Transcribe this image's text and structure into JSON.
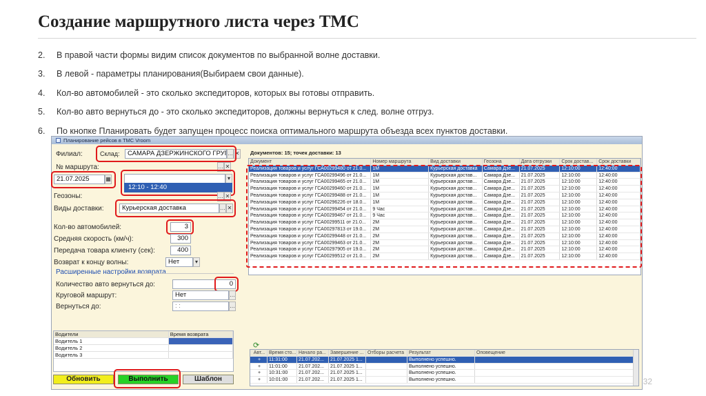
{
  "slide": {
    "title": "Создание маршрутного листа через ТМС",
    "points": [
      {
        "num": "2.",
        "text": "В правой части формы видим список  документов по выбранной волне доставки."
      },
      {
        "num": "3.",
        "text": "В левой - параметры планирования(Выбираем свои данные)."
      },
      {
        "num": "4.",
        "text": "Кол-во автомобилей - это сколько экспедиторов, которых вы готовы отправить."
      },
      {
        "num": "5.",
        "text": "Кол-во авто вернуться до - это сколько экспедиторов, должны вернуться к след. волне отгруз."
      },
      {
        "num": "6.",
        "text": "По кнопке Планировать будет запущен процесс поиска оптимального маршрута объезда всех пунктов доставки."
      }
    ],
    "page_number": "32"
  },
  "window": {
    "title": "Планирование рейсов в ТМС Vroom",
    "form": {
      "branch_label": "Филиал:",
      "warehouse_label": "Склад:",
      "warehouse_value": "САМАРА ДЗЕРЖИНСКОГО ГРУППА",
      "route_label": "№ маршрута:",
      "date_value": "21.07.2025",
      "wave_value": "",
      "wave_option": "12:10 - 12:40",
      "geozones_label": "Геозоны:",
      "delivery_types_label": "Виды доставки:",
      "delivery_types_value": "Курьерская доставка",
      "cars_label": "Кол-во автомобилей:",
      "cars_value": "3",
      "speed_label": "Средняя скорость (км/ч):",
      "speed_value": "300",
      "handover_label": "Передача товара клиенту (сек):",
      "handover_value": "400",
      "return_label": "Возврат к концу волны:",
      "return_value": "Нет",
      "advanced_title": "Расширенные настройки возврата",
      "return_cars_label": "Количество авто вернуться до:",
      "return_cars_value": "0",
      "circular_label": "Круговой маршрут:",
      "circular_value": "Нет",
      "return_until_label": "Вернуться до:",
      "return_until_value": ": :"
    },
    "drivers": {
      "headers": [
        "Водители",
        "Время возврата"
      ],
      "rows": [
        "Водитель 1",
        "Водитель 2",
        "Водитель 3"
      ]
    },
    "buttons": {
      "refresh": "Обновить",
      "run": "Выполнить",
      "template": "Шаблон"
    },
    "documents": {
      "caption": "Документов: 15; точек доставки: 13",
      "headers": [
        "Документ",
        "Номер маршрута",
        "Вид доставки",
        "Геозона",
        "Дата отгрузки",
        "Срок достав...",
        "Срок доставки"
      ],
      "rows": [
        [
          "Реализация товаров и услуг ГСА00299480 от 21.0...",
          "1М",
          "Курьерская доставка",
          "Самара Дзе...",
          "21.07.2025",
          "12:10:00",
          "12:40:00"
        ],
        [
          "Реализация товаров и услуг ГСА00299496 от 21.0...",
          "1М",
          "Курьерская достав...",
          "Самара Дзе...",
          "21.07.2025",
          "12:10:00",
          "12:40:00"
        ],
        [
          "Реализация товаров и услуг ГСА00299465 от 21.0...",
          "1М",
          "Курьерская достав...",
          "Самара Дзе...",
          "21.07.2025",
          "12:10:00",
          "12:40:00"
        ],
        [
          "Реализация товаров и услуг ГСА00299460 от 21.0...",
          "1М",
          "Курьерская достав...",
          "Самара Дзе...",
          "21.07.2025",
          "12:10:00",
          "12:40:00"
        ],
        [
          "Реализация товаров и услуг ГСА00299488 от 21.0...",
          "1М",
          "Курьерская достав...",
          "Самара Дзе...",
          "21.07.2025",
          "12:10:00",
          "12:40:00"
        ],
        [
          "Реализация товаров и услуг ГСА00296226 от 18.0...",
          "1М",
          "Курьерская достав...",
          "Самара Дзе...",
          "21.07.2025",
          "12:10:00",
          "12:40:00"
        ],
        [
          "Реализация товаров и услуг ГСА00299454 от 21.0...",
          "9 Час",
          "Курьерская достав...",
          "Самара Дзе...",
          "21.07.2025",
          "12:10:00",
          "12:40:00"
        ],
        [
          "Реализация товаров и услуг ГСА00299467 от 21.0...",
          "9 Час",
          "Курьерская достав...",
          "Самара Дзе...",
          "21.07.2025",
          "12:10:00",
          "12:40:00"
        ],
        [
          "Реализация товаров и услуг ГСА00299511 от 21.0...",
          "2М",
          "Курьерская достав...",
          "Самара Дзе...",
          "21.07.2025",
          "12:10:00",
          "12:40:00"
        ],
        [
          "Реализация товаров и услуг ГСА00297813 от 19.0...",
          "2М",
          "Курьерская достав...",
          "Самара Дзе...",
          "21.07.2025",
          "12:10:00",
          "12:40:00"
        ],
        [
          "Реализация товаров и услуг ГСА00299448 от 21.0...",
          "2М",
          "Курьерская достав...",
          "Самара Дзе...",
          "21.07.2025",
          "12:10:00",
          "12:40:00"
        ],
        [
          "Реализация товаров и услуг ГСА00299463 от 21.0...",
          "2М",
          "Курьерская достав...",
          "Самара Дзе...",
          "21.07.2025",
          "12:10:00",
          "12:40:00"
        ],
        [
          "Реализация товаров и услуг ГСА00297905 от 19.0...",
          "2М",
          "Курьерская достав...",
          "Самара Дзе...",
          "21.07.2025",
          "12:10:00",
          "12:40:00"
        ],
        [
          "Реализация товаров и услуг ГСА00299512 от 21.0...",
          "2М",
          "Курьерская достав...",
          "Самара Дзе...",
          "21.07.2025",
          "12:10:00",
          "12:40:00"
        ]
      ]
    },
    "results": {
      "headers": [
        "Авт...",
        "Время сто...",
        "Начало ра...",
        "Завершение ...",
        "Отборы расчета",
        "Результат",
        "Оповещение"
      ],
      "rows": [
        [
          "+",
          "11:31:00",
          "21.07.202...",
          "21.07.2025 1...",
          "",
          "Выполнено успешно.",
          ""
        ],
        [
          "+",
          "11:01:00",
          "21.07.202...",
          "21.07.2025 1...",
          "",
          "Выполнено успешно.",
          ""
        ],
        [
          "+",
          "10:31:00",
          "21.07.202...",
          "21.07.2025 1...",
          "",
          "Выполнено успешно.",
          ""
        ],
        [
          "+",
          "10:01:00",
          "21.07.202...",
          "21.07.2025 1...",
          "",
          "Выполнено успешно.",
          ""
        ]
      ]
    }
  },
  "colors": {
    "highlight": "#e0191b",
    "selection": "#2f5fb3",
    "form_background": "#fbf5dc",
    "refresh_button": "#f2ee1c",
    "run_button": "#26d126"
  }
}
